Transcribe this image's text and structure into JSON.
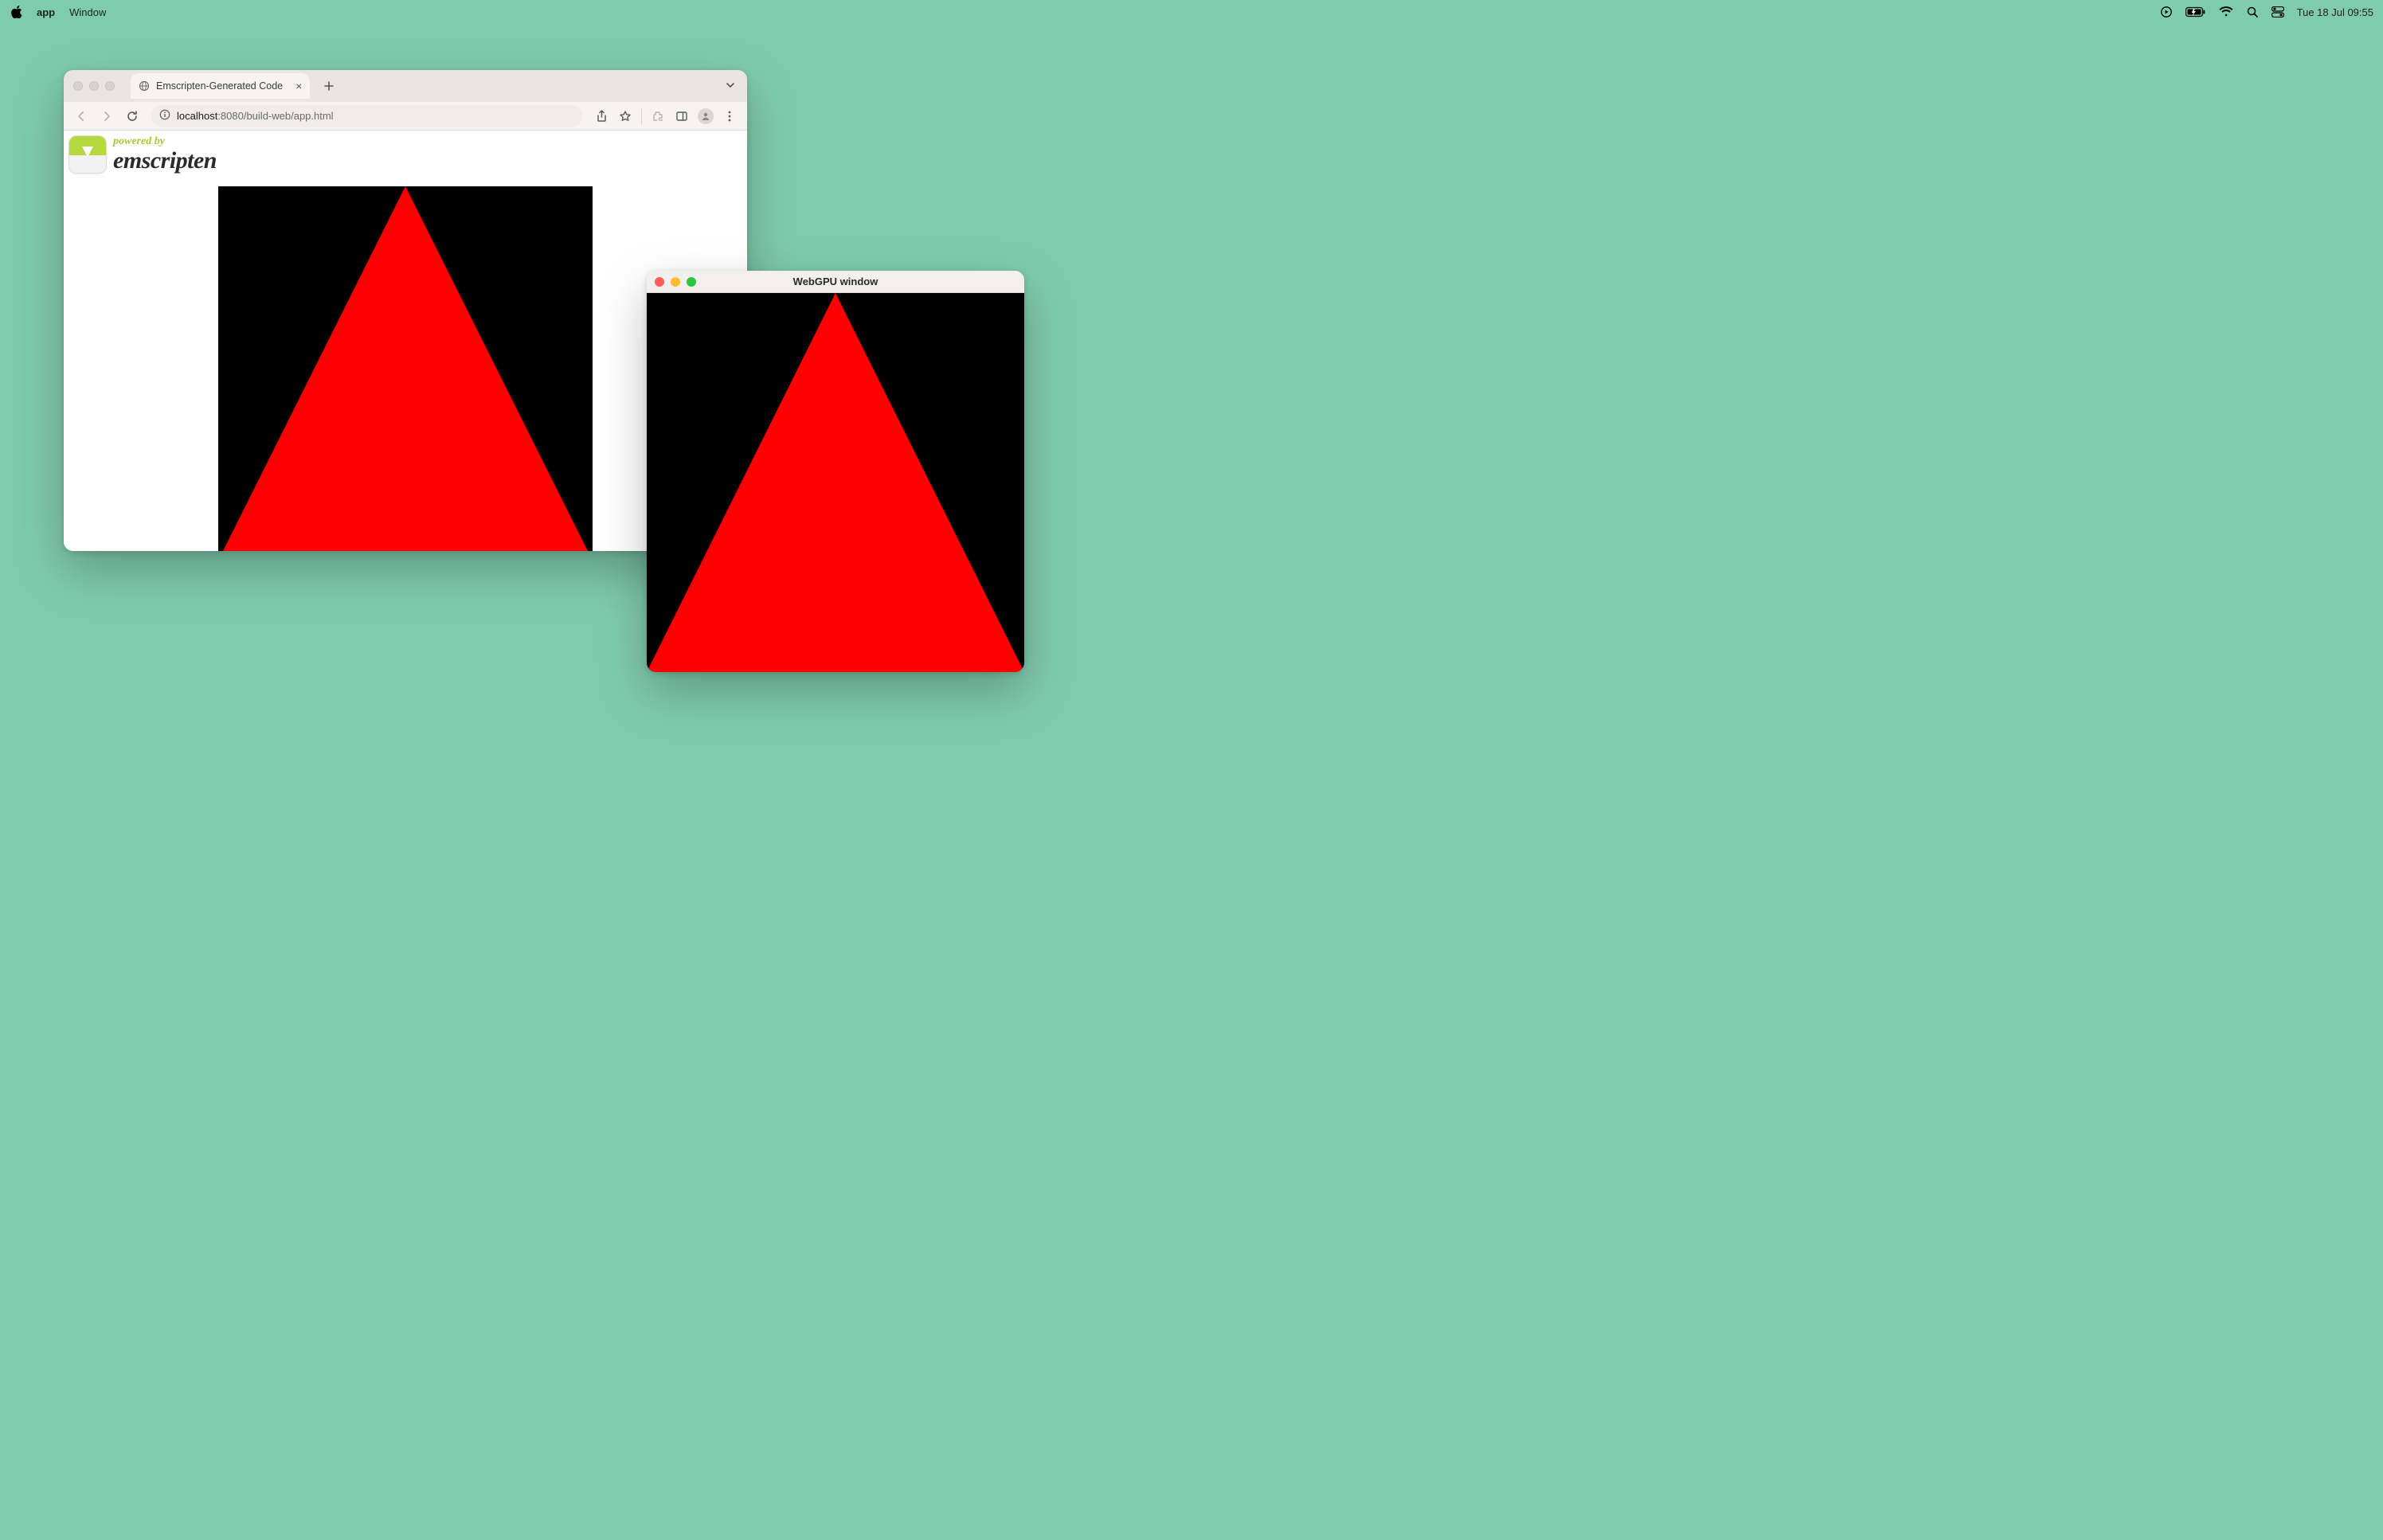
{
  "menubar": {
    "app": "app",
    "items": [
      "Window"
    ],
    "clock": "Tue 18 Jul  09:55"
  },
  "browser": {
    "tab_title": "Emscripten-Generated Code",
    "url_host": "localhost",
    "url_rest": ":8080/build-web/app.html",
    "banner_powered": "powered by",
    "banner_name": "emscripten"
  },
  "native": {
    "title": "WebGPU window"
  },
  "colors": {
    "desktop": "#7fcbaf",
    "triangle": "#ff0000",
    "canvas_bg": "#000000"
  }
}
